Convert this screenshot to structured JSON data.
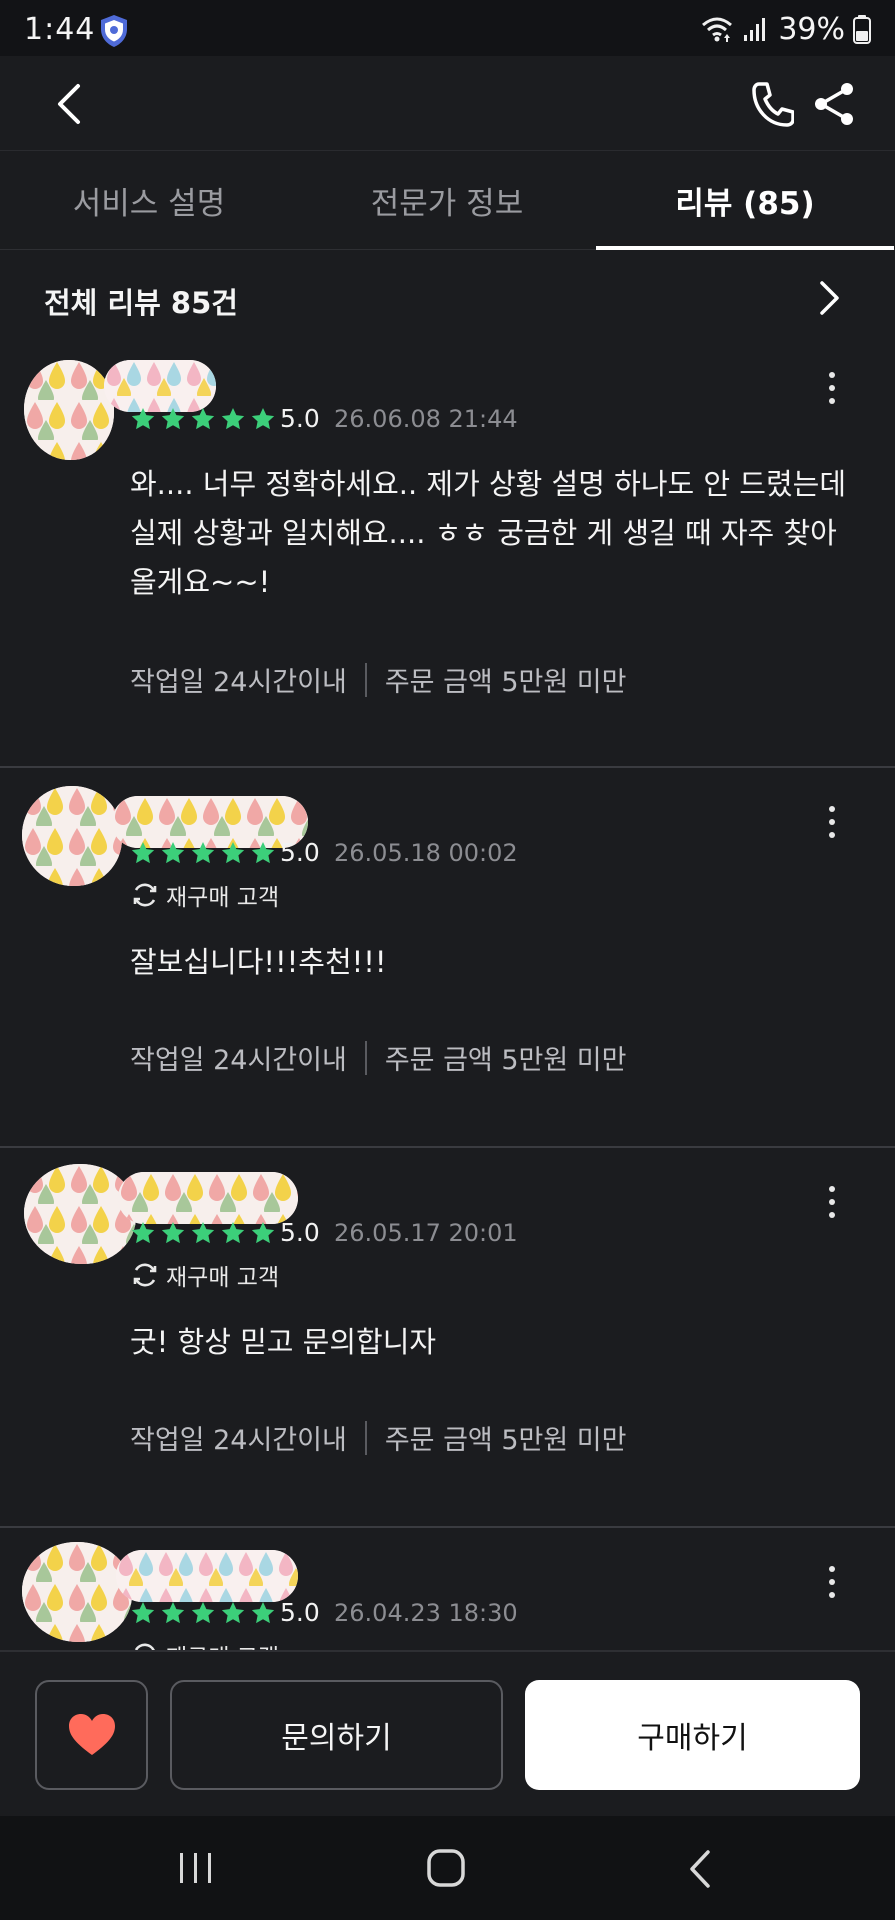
{
  "status_bar": {
    "time": "1:44",
    "battery": "39%"
  },
  "tabs": [
    {
      "label": "서비스 설명",
      "active": false
    },
    {
      "label": "전문가 정보",
      "active": false
    },
    {
      "label": "리뷰 (85)",
      "active": true
    }
  ],
  "reviews_header": {
    "title": "전체 리뷰 85건"
  },
  "reviews": [
    {
      "rating": "5.0",
      "stars": 5,
      "date": "26.06.08 21:44",
      "repurchase": "",
      "text": "와.... 너무 정확하세요.. 제가 상황 설명 하나도 안 드렸는데 실제 상황과 일치해요.... ㅎㅎ 궁금한 게 생길 때 자주 찾아올게요~~!",
      "work_period": "작업일 24시간이내",
      "order_amount": "주문 금액 5만원 미만"
    },
    {
      "rating": "5.0",
      "stars": 5,
      "date": "26.05.18 00:02",
      "repurchase": "재구매 고객",
      "text": "잘보십니다!!!추천!!!",
      "work_period": "작업일 24시간이내",
      "order_amount": "주문 금액 5만원 미만"
    },
    {
      "rating": "5.0",
      "stars": 5,
      "date": "26.05.17 20:01",
      "repurchase": "재구매 고객",
      "text": "굿! 항상 믿고 문의합니자",
      "work_period": "작업일 24시간이내",
      "order_amount": "주문 금액 5만원 미만"
    },
    {
      "rating": "5.0",
      "stars": 5,
      "date": "26.04.23 18:30",
      "repurchase": "재구매 고객"
    }
  ],
  "actions": {
    "ask_label": "문의하기",
    "buy_label": "구매하기"
  },
  "colors": {
    "background": "#1b1c1f",
    "star_green": "#3ccf7a",
    "heart_red": "#ff6b5b",
    "buy_button": "#ffffff"
  },
  "icons": [
    "back-icon",
    "phone-icon",
    "share-icon",
    "chevron-right-icon",
    "more-vertical-icon",
    "star-icon",
    "repurchase-icon",
    "heart-icon",
    "recent-apps-icon",
    "home-icon",
    "nav-back-icon"
  ]
}
